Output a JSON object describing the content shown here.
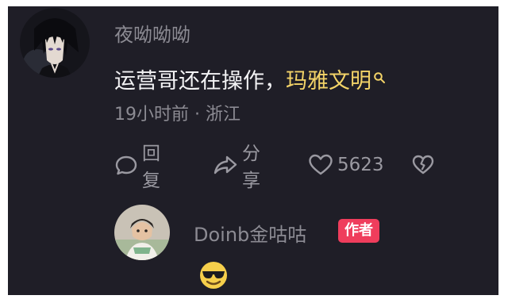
{
  "comment": {
    "username": "夜呦呦呦",
    "text_main": "运营哥还在操作",
    "text_sep": "，",
    "keyword": "玛雅文明",
    "meta": "19小时前 · 浙江",
    "actions": {
      "reply_label": "回复",
      "share_label": "分享",
      "like_count": "5623"
    }
  },
  "reply": {
    "username": "Doinb金咕咕",
    "author_badge": "作者"
  },
  "icons": {
    "reply": "speech-bubble-icon",
    "share": "share-arrow-icon",
    "like": "heart-outline-icon",
    "dislike": "broken-heart-icon",
    "search": "search-icon",
    "emoji": "sunglasses-emoji"
  },
  "colors": {
    "background": "#1f1e27",
    "keyword": "#f4d468",
    "muted_text": "#8c8b93",
    "primary_text": "#f3f3f5",
    "author_badge": "#ef3d5c"
  }
}
